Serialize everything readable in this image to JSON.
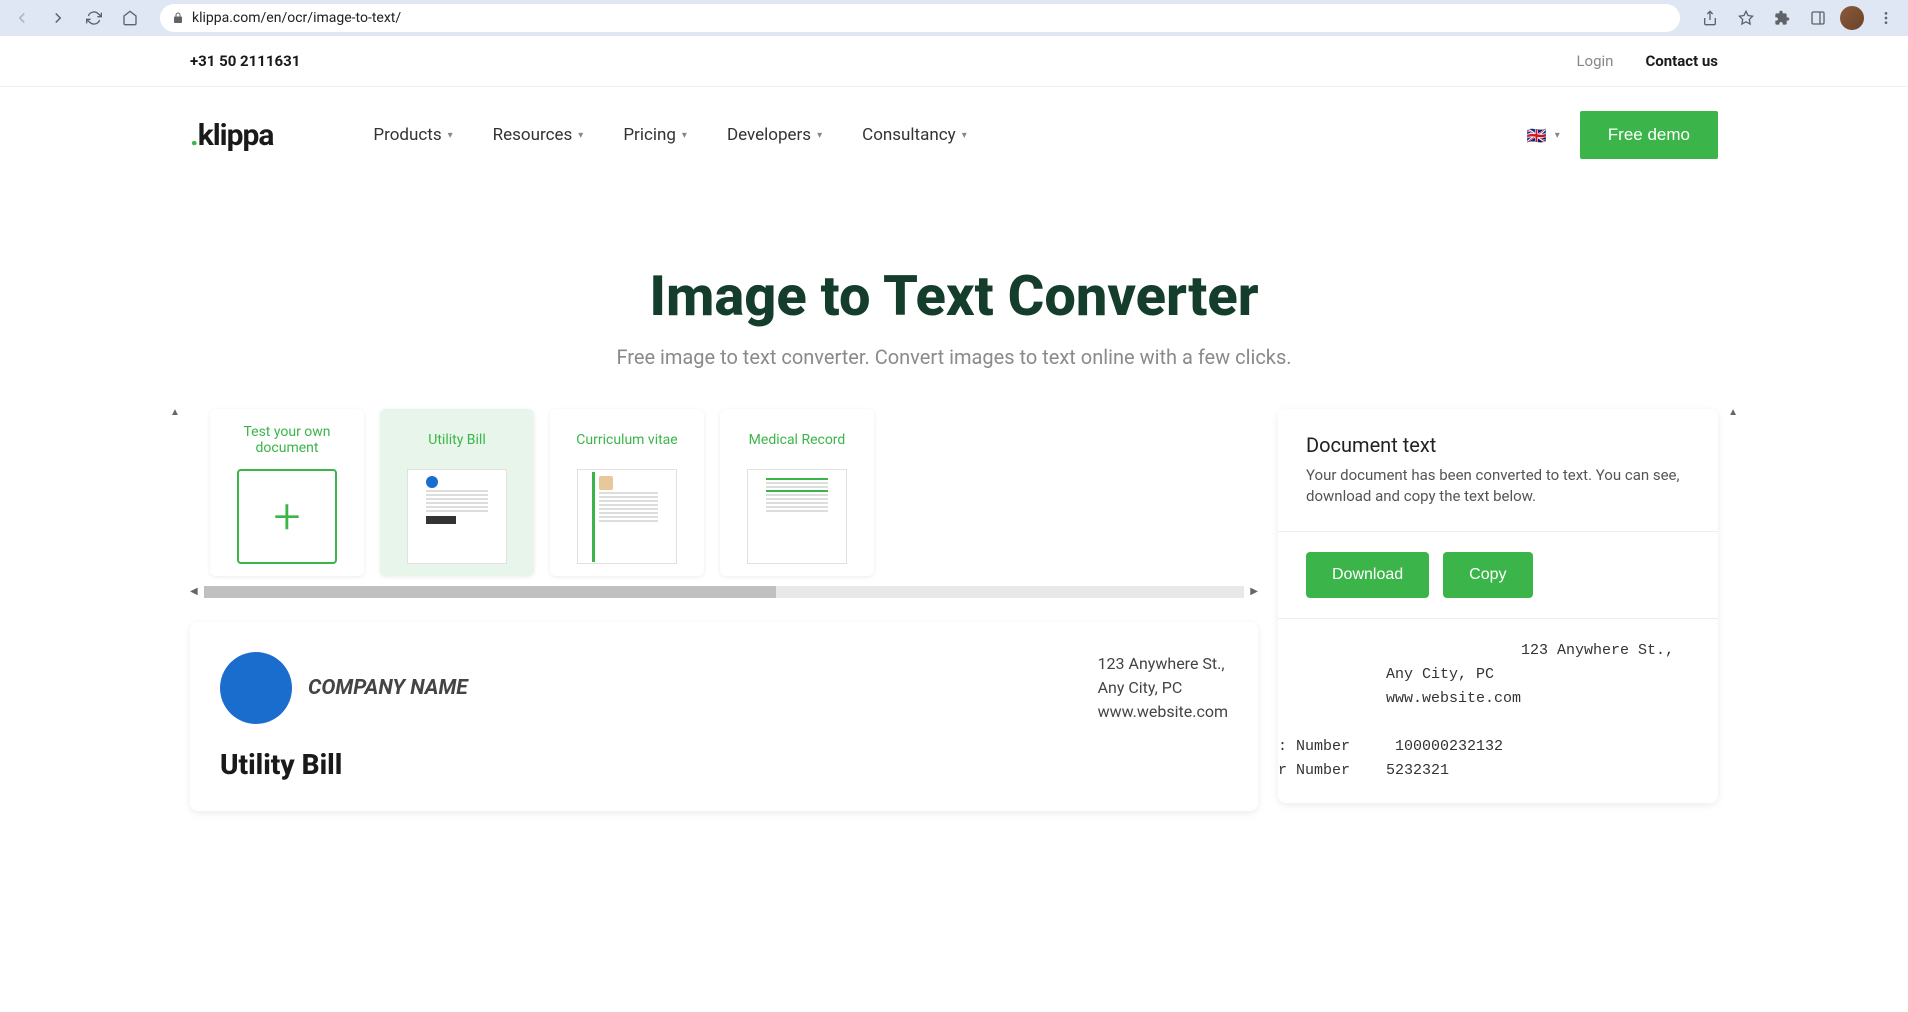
{
  "browser": {
    "url": "klippa.com/en/ocr/image-to-text/"
  },
  "topbar": {
    "phone": "+31 50 2111631",
    "login": "Login",
    "contact": "Contact us"
  },
  "nav": {
    "logo": "klippa",
    "items": [
      "Products",
      "Resources",
      "Pricing",
      "Developers",
      "Consultancy"
    ],
    "cta": "Free demo"
  },
  "hero": {
    "title": "Image to Text Converter",
    "subtitle": "Free image to text converter. Convert images to text online with a few clicks."
  },
  "cards": [
    {
      "label": "Test your own document",
      "type": "upload"
    },
    {
      "label": "Utility Bill",
      "type": "utility",
      "active": true
    },
    {
      "label": "Curriculum vitae",
      "type": "cv"
    },
    {
      "label": "Medical Record",
      "type": "medical"
    }
  ],
  "preview": {
    "company_name": "COMPANY NAME",
    "address_line1": "123 Anywhere St.,",
    "address_line2": "Any City, PC",
    "address_line3": "www.website.com",
    "doc_title": "Utility Bill"
  },
  "result": {
    "title": "Document text",
    "description": "Your document has been converted to text. You can see, download and copy the text below.",
    "download": "Download",
    "copy": "Copy",
    "text_lines": [
      "                           123 Anywhere St.,",
      "            Any City, PC",
      "            www.website.com",
      "",
      ": Number     100000232132",
      "r Number    5232321"
    ]
  }
}
